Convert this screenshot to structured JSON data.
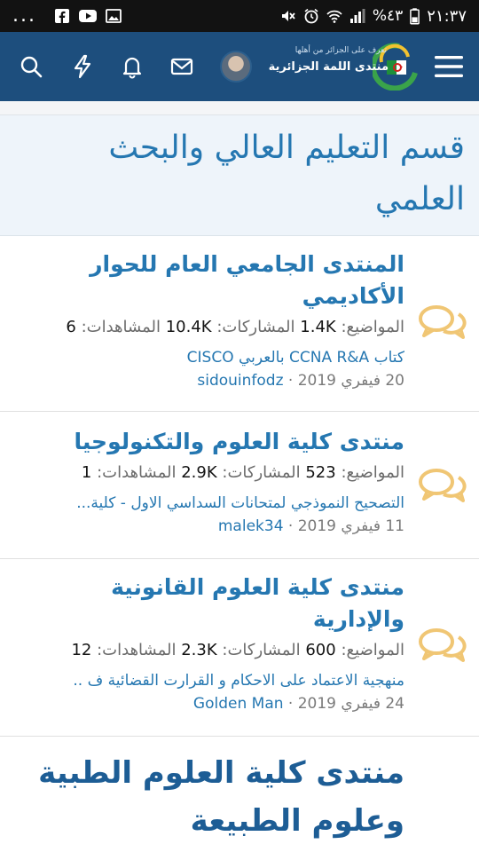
{
  "status_bar": {
    "time": "٢١:٣٧",
    "battery": "%٤٣",
    "more": "...",
    "icons": [
      "photo-icon",
      "youtube-icon",
      "facebook-icon",
      "mute-icon",
      "alarm-icon",
      "wifi-icon",
      "signal-icon",
      "battery-icon"
    ]
  },
  "header": {
    "logo_line1": "تعرف على الجزائر من أهلها",
    "logo_line2": "منتدى اللمة الجزائرية",
    "icons": [
      "menu-icon",
      "logo",
      "avatar",
      "mail-icon",
      "bell-icon",
      "lightning-icon",
      "search-icon"
    ],
    "colors": {
      "bar": "#1d4e7d",
      "link": "#2577b1",
      "chat_icon": "#f0c674"
    }
  },
  "category": {
    "title": "قسم التعليم العالي والبحث العلمي"
  },
  "nodes": [
    {
      "title": "المنتدى الجامعي العام للحوار الأكاديمي",
      "threads_label": "المواضيع:",
      "threads": "1.4K",
      "posts_label": "المشاركات:",
      "posts": "10.4K",
      "views_label": "المشاهدات:",
      "views": "6",
      "last_title": "كتاب CCNA R&A بالعربي CISCO",
      "last_date": "20 فيفري 2019",
      "last_user": "sidouinfodz"
    },
    {
      "title": "منتدى كلية العلوم والتكنولوجيا",
      "threads_label": "المواضيع:",
      "threads": "523",
      "posts_label": "المشاركات:",
      "posts": "2.9K",
      "views_label": "المشاهدات:",
      "views": "1",
      "last_title": "التصحيح النموذجي لمتحانات السداسي الاول - كلية...",
      "last_date": "11 فيفري 2019",
      "last_user": "malek34"
    },
    {
      "title": "منتدى كلية العلوم القانونية والإدارية",
      "threads_label": "المواضيع:",
      "threads": "600",
      "posts_label": "المشاركات:",
      "posts": "2.3K",
      "views_label": "المشاهدات:",
      "views": "12",
      "last_title": "منهجية الاعتماد على الاحكام و القرارت القضائية ف ..",
      "last_date": "24 فيفري 2019",
      "last_user": "Golden Man"
    },
    {
      "title": "منتدى كلية العلوم الطبية وعلوم الطبيعة"
    }
  ],
  "separator": "·"
}
